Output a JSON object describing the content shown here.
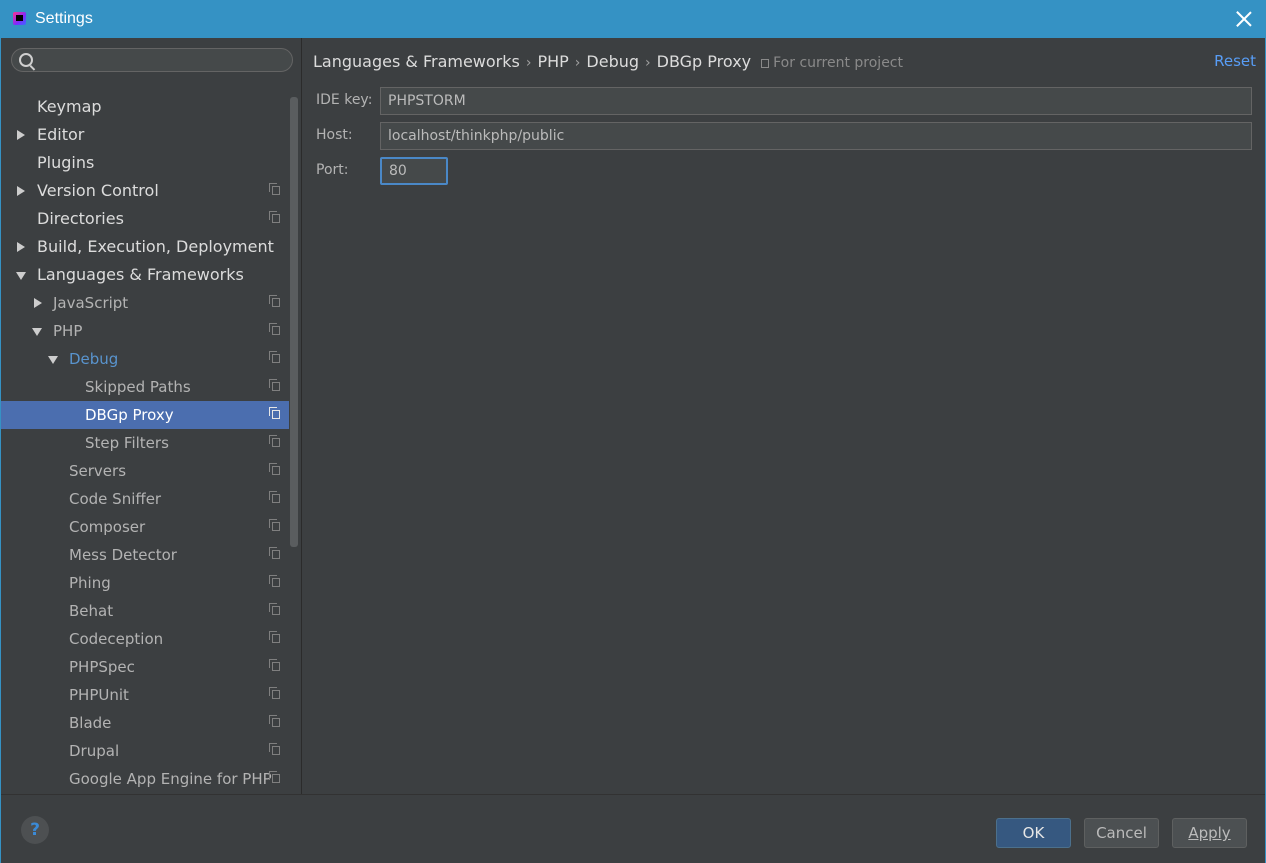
{
  "window": {
    "title": "Settings"
  },
  "search": {
    "placeholder": "",
    "value": ""
  },
  "sidebar": {
    "items": [
      {
        "label": "Keymap"
      },
      {
        "label": "Editor"
      },
      {
        "label": "Plugins"
      },
      {
        "label": "Version Control"
      },
      {
        "label": "Directories"
      },
      {
        "label": "Build, Execution, Deployment"
      },
      {
        "label": "Languages & Frameworks"
      },
      {
        "label": "JavaScript"
      },
      {
        "label": "PHP"
      },
      {
        "label": "Debug"
      },
      {
        "label": "Skipped Paths"
      },
      {
        "label": "DBGp Proxy"
      },
      {
        "label": "Step Filters"
      },
      {
        "label": "Servers"
      },
      {
        "label": "Code Sniffer"
      },
      {
        "label": "Composer"
      },
      {
        "label": "Mess Detector"
      },
      {
        "label": "Phing"
      },
      {
        "label": "Behat"
      },
      {
        "label": "Codeception"
      },
      {
        "label": "PHPSpec"
      },
      {
        "label": "PHPUnit"
      },
      {
        "label": "Blade"
      },
      {
        "label": "Drupal"
      },
      {
        "label": "Google App Engine for PHP"
      }
    ]
  },
  "breadcrumb": {
    "items": [
      "Languages & Frameworks",
      "PHP",
      "Debug",
      "DBGp Proxy"
    ],
    "scope": "For current project"
  },
  "reset_label": "Reset",
  "form": {
    "ide_key": {
      "label": "IDE key:",
      "value": "PHPSTORM"
    },
    "host": {
      "label": "Host:",
      "value": "localhost/thinkphp/public"
    },
    "port": {
      "label": "Port:",
      "value": "80"
    }
  },
  "buttons": {
    "help": "?",
    "ok": "OK",
    "cancel": "Cancel",
    "apply": "Apply"
  },
  "colors": {
    "title_bar": "#3592c4",
    "background": "#3c3f41",
    "selection": "#4b6eaf",
    "link": "#589df6",
    "focus": "#4a88c7"
  }
}
